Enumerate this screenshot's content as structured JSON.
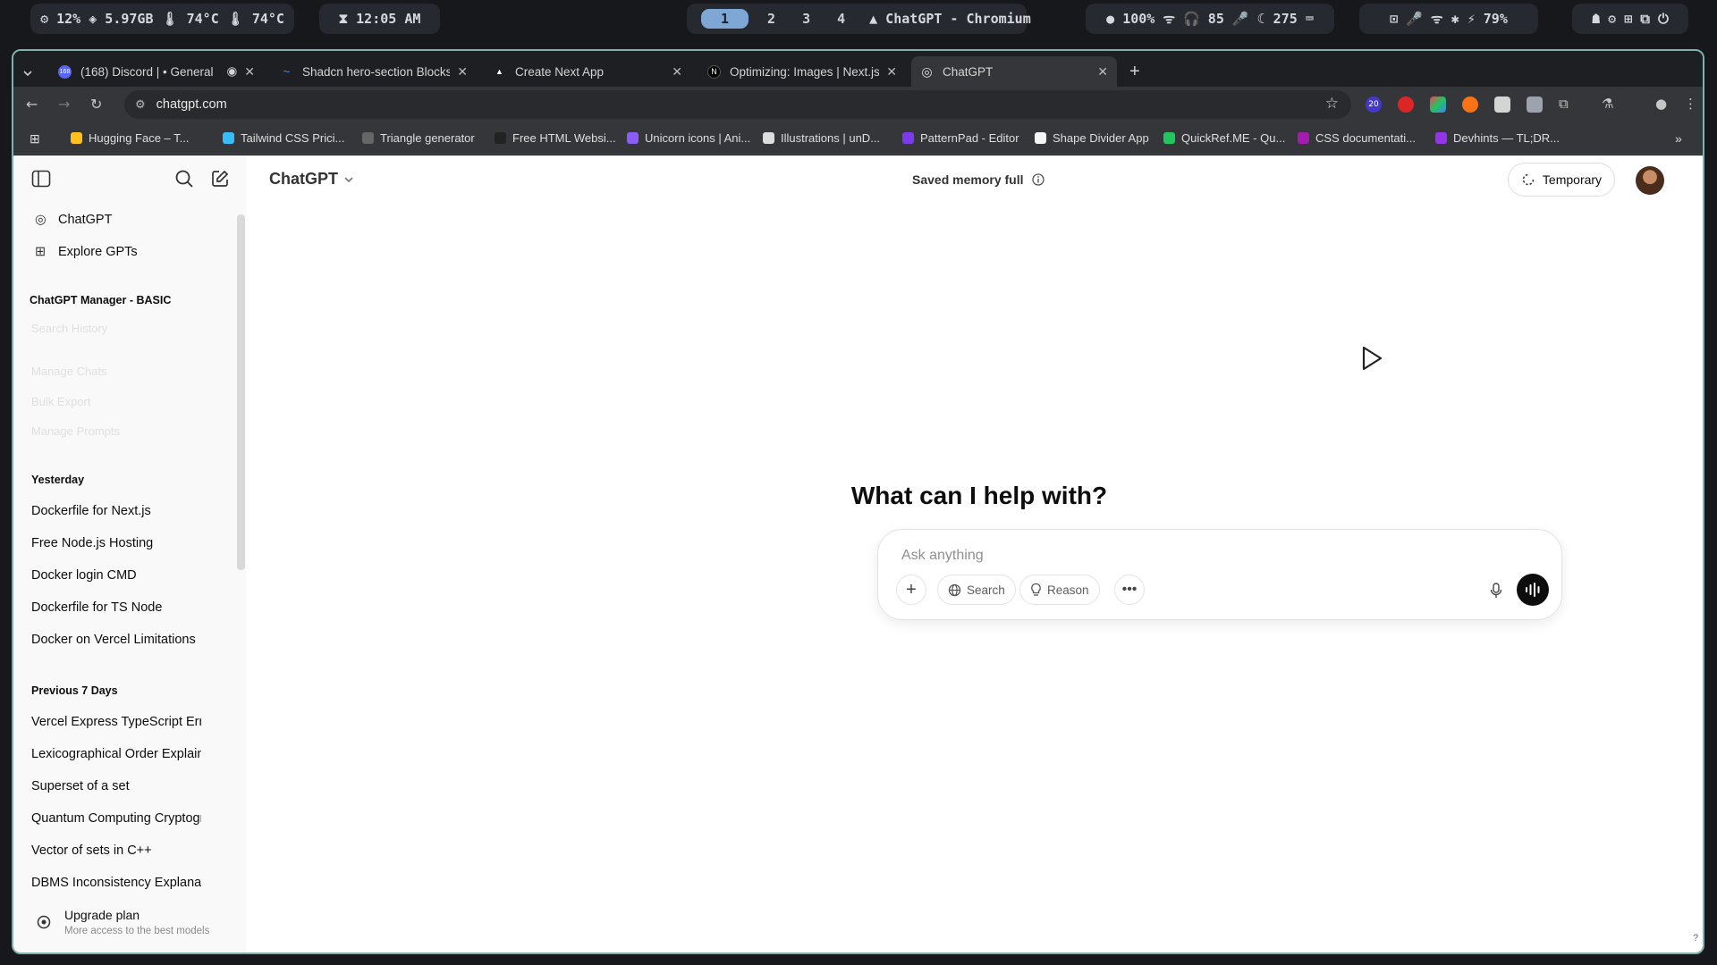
{
  "topbar": {
    "system_stats": "⚙ 12%  ◈ 5.97GB  🌡 74°C  🌡 74°C",
    "clock": "⧗ 12:05 AM",
    "workspaces": [
      "1",
      "2",
      "3",
      "4"
    ],
    "window_title": "▲ ChatGPT - Chromium",
    "status_right": "● 100%  ᯤ  🎧 85  🎤  ☾ 275  ⌨",
    "tray": "⊡  🎤  ᯤ  ✱  ⚡ 79%",
    "tray2": "☗  ⚙  ⊞  ⧉  ⏻"
  },
  "tabs": [
    {
      "title": "(168) Discord | • General",
      "fav_color": "#5865f2",
      "fav_text": "168"
    },
    {
      "title": "Shadcn hero-section Blocks",
      "fav_color": "#3b82f6",
      "fav_text": "~"
    },
    {
      "title": "Create Next App",
      "fav_color": "#1e1f22",
      "fav_text": "▲"
    },
    {
      "title": "Optimizing: Images | Next.js",
      "fav_color": "#000000",
      "fav_text": "N"
    },
    {
      "title": "ChatGPT",
      "fav_color": "#5a5a5a",
      "fav_text": "◎"
    }
  ],
  "new_tab": "+",
  "address": {
    "url": "chatgpt.com"
  },
  "extensions_badge": "20",
  "bookmarks": [
    {
      "label": "Hugging Face – T...",
      "color": "#ffbf1f"
    },
    {
      "label": "Tailwind CSS Prici...",
      "color": "#38bdf8"
    },
    {
      "label": "Triangle generator",
      "color": "#666666"
    },
    {
      "label": "Free HTML Websi...",
      "color": "#222222"
    },
    {
      "label": "Unicorn icons | Ani...",
      "color": "#8b5cf6"
    },
    {
      "label": "Illustrations | unD...",
      "color": "#dddddd"
    },
    {
      "label": "PatternPad - Editor",
      "color": "#7c3aed"
    },
    {
      "label": "Shape Divider App",
      "color": "#f5f5f5"
    },
    {
      "label": "QuickRef.ME - Qu...",
      "color": "#22c55e"
    },
    {
      "label": "CSS documentati...",
      "color": "#a21caf"
    },
    {
      "label": "Devhints — TL;DR...",
      "color": "#9333ea"
    }
  ],
  "sidebar": {
    "top_items": [
      "ChatGPT",
      "Explore GPTs"
    ],
    "gpt_section": "ChatGPT Manager - BASIC",
    "ghost_items": [
      "Search History",
      "Manage Chats",
      "Bulk Export",
      "Manage Prompts"
    ],
    "yesterday_label": "Yesterday",
    "yesterday": [
      "Dockerfile for Next.js",
      "Free Node.js Hosting",
      "Docker login CMD",
      "Dockerfile for TS Node",
      "Docker on Vercel Limitations"
    ],
    "prev7_label": "Previous 7 Days",
    "prev7": [
      "Vercel Express TypeScript Error",
      "Lexicographical Order Explained",
      "Superset of a set",
      "Quantum Computing Cryptography",
      "Vector of sets in C++",
      "DBMS Inconsistency Explanation"
    ],
    "upgrade_title": "Upgrade plan",
    "upgrade_sub": "More access to the best models"
  },
  "header": {
    "model": "ChatGPT",
    "memory": "Saved memory full",
    "temporary": "Temporary"
  },
  "main": {
    "heading": "What can I help with?",
    "placeholder": "Ask anything",
    "search_label": "Search",
    "reason_label": "Reason",
    "help": "?"
  }
}
